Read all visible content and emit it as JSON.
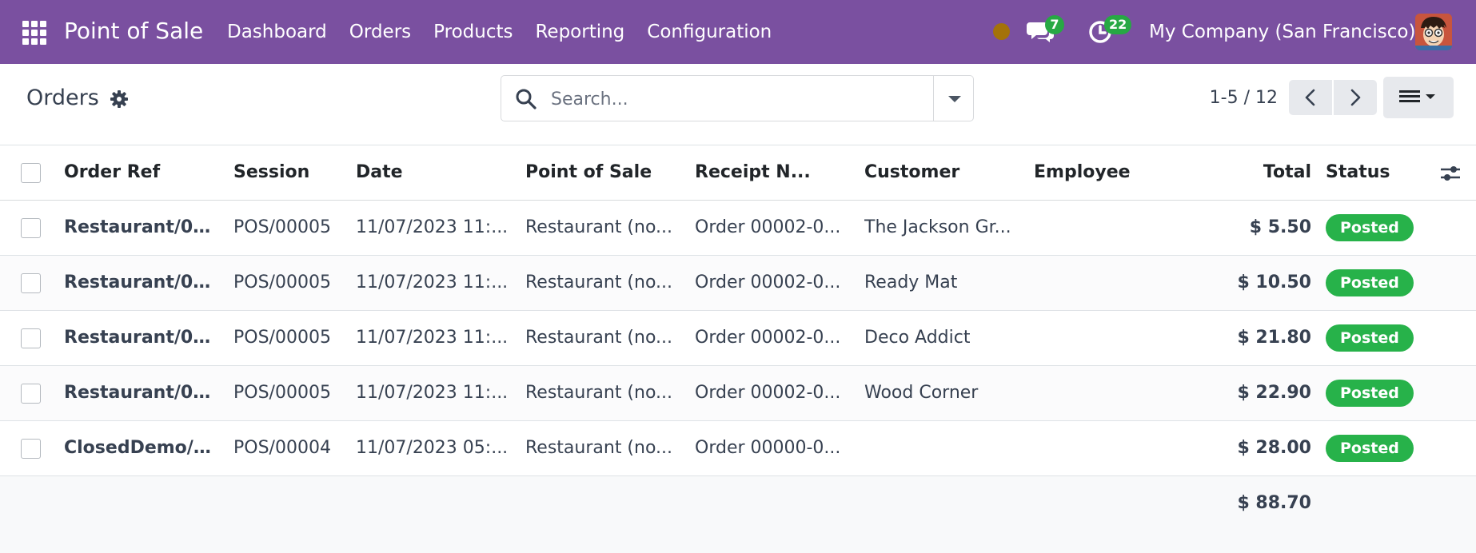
{
  "navbar": {
    "app_name": "Point of Sale",
    "menu": [
      "Dashboard",
      "Orders",
      "Products",
      "Reporting",
      "Configuration"
    ],
    "chat_count": "7",
    "activity_count": "22",
    "company": "My Company (San Francisco)",
    "status_color": "#a4720a",
    "brand_color": "#7a50a0"
  },
  "control": {
    "title": "Orders",
    "search_placeholder": "Search...",
    "pager": "1-5 / 12"
  },
  "table": {
    "columns": [
      "Order Ref",
      "Session",
      "Date",
      "Point of Sale",
      "Receipt N...",
      "Customer",
      "Employee",
      "Total",
      "Status"
    ],
    "rows": [
      {
        "ref": "Restaurant/00...",
        "session": "POS/00005",
        "date": "11/07/2023 11:...",
        "pos": "Restaurant (no...",
        "receipt": "Order 00002-0...",
        "customer": "The Jackson Gr...",
        "employee": "",
        "total": "$ 5.50",
        "status": "Posted"
      },
      {
        "ref": "Restaurant/00...",
        "session": "POS/00005",
        "date": "11/07/2023 11:...",
        "pos": "Restaurant (no...",
        "receipt": "Order 00002-0...",
        "customer": "Ready Mat",
        "employee": "",
        "total": "$ 10.50",
        "status": "Posted"
      },
      {
        "ref": "Restaurant/00...",
        "session": "POS/00005",
        "date": "11/07/2023 11:...",
        "pos": "Restaurant (no...",
        "receipt": "Order 00002-0...",
        "customer": "Deco Addict",
        "employee": "",
        "total": "$ 21.80",
        "status": "Posted"
      },
      {
        "ref": "Restaurant/00...",
        "session": "POS/00005",
        "date": "11/07/2023 11:...",
        "pos": "Restaurant (no...",
        "receipt": "Order 00002-0...",
        "customer": "Wood Corner",
        "employee": "",
        "total": "$ 22.90",
        "status": "Posted"
      },
      {
        "ref": "ClosedDemo/0...",
        "session": "POS/00004",
        "date": "11/07/2023 05:...",
        "pos": "Restaurant (no...",
        "receipt": "Order 00000-0...",
        "customer": "",
        "employee": "",
        "total": "$ 28.00",
        "status": "Posted"
      }
    ],
    "grand_total": "$ 88.70",
    "status_color": "#27b24a"
  }
}
